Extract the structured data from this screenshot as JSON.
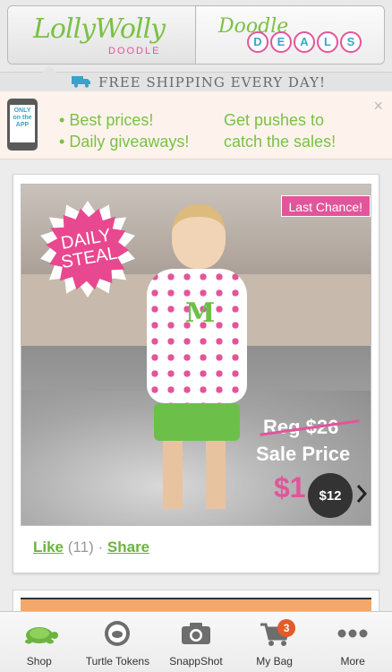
{
  "header": {
    "brand_main": "LollyWolly",
    "brand_sub": "DOODLE",
    "deals_word": "Doodle",
    "deals_letters": [
      "D",
      "E",
      "A",
      "L",
      "S"
    ]
  },
  "shipping": {
    "text": "FREE SHIPPING EVERY DAY!"
  },
  "promo": {
    "phone_line1": "ONLY",
    "phone_line2": "on the",
    "phone_line3": "APP",
    "bullets": [
      "Best prices!",
      "Daily giveaways!"
    ],
    "right_line1": "Get pushes to",
    "right_line2": "catch the sales!",
    "close": "×"
  },
  "product": {
    "badge_line1": "DAILY",
    "badge_line2": "STEAL",
    "last_chance": "Last Chance!",
    "regular_price": "Reg $26",
    "sale_label": "Sale Price",
    "sale_price_partial": "$1",
    "bubble_price": "$12",
    "monogram": "M"
  },
  "social": {
    "like_label": "Like",
    "like_count": "(11)",
    "separator": "·",
    "share_label": "Share"
  },
  "tabs": [
    {
      "label": "Shop",
      "icon": "turtle-icon"
    },
    {
      "label": "Turtle Tokens",
      "icon": "token-icon"
    },
    {
      "label": "SnappShot",
      "icon": "camera-icon"
    },
    {
      "label": "My Bag",
      "icon": "cart-icon",
      "badge": "3"
    },
    {
      "label": "More",
      "icon": "more-dots-icon"
    }
  ],
  "colors": {
    "brand_green": "#7ac143",
    "brand_pink": "#e2559a",
    "accent_blue": "#35a7c9",
    "badge_orange": "#e25b2a"
  }
}
